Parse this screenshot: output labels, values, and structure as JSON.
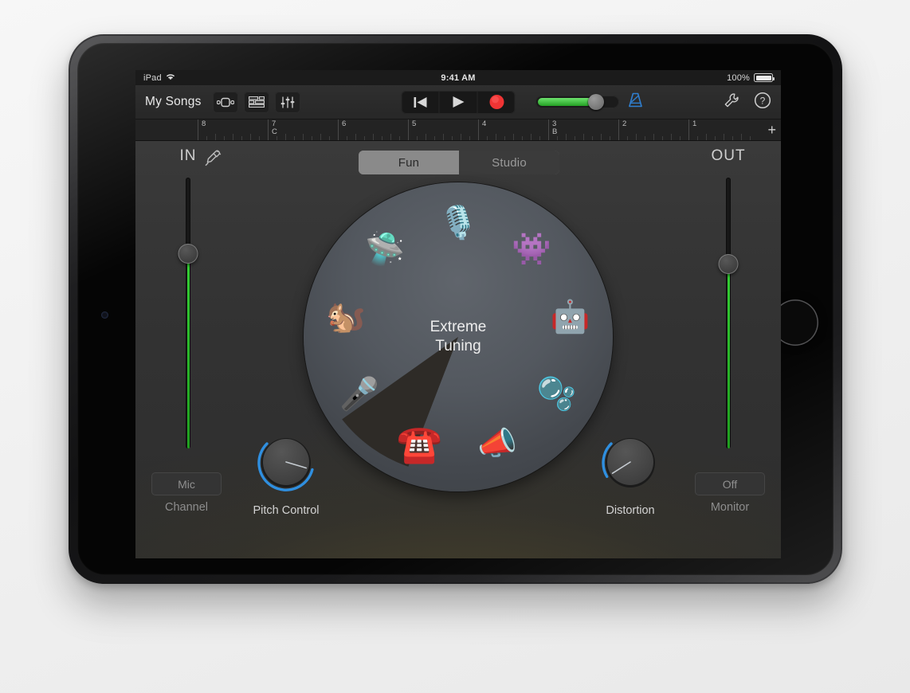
{
  "status_bar": {
    "device": "iPad",
    "wifi_icon": "wifi-icon",
    "time": "9:41 AM",
    "battery_percent": "100%"
  },
  "toolbar": {
    "my_songs_label": "My Songs",
    "icons": [
      {
        "name": "instrument-view-icon",
        "label": "Instrument View"
      },
      {
        "name": "tracks-view-icon",
        "label": "Tracks View"
      },
      {
        "name": "mixer-icon",
        "label": "Mixer"
      }
    ],
    "transport": {
      "rewind_label": "Rewind",
      "play_label": "Play",
      "record_label": "Record",
      "record_color": "#f03030"
    },
    "master_volume": {
      "value": 72,
      "fill_color": "#35c335"
    },
    "metronome_label": "Metronome",
    "metronome_color": "#2f7fd0",
    "settings_label": "Settings",
    "help_label": "Help"
  },
  "ruler": {
    "bars": [
      {
        "num": "1",
        "marker": ""
      },
      {
        "num": "2",
        "marker": ""
      },
      {
        "num": "3",
        "marker": "B"
      },
      {
        "num": "4",
        "marker": ""
      },
      {
        "num": "5",
        "marker": ""
      },
      {
        "num": "6",
        "marker": ""
      },
      {
        "num": "7",
        "marker": "C"
      },
      {
        "num": "8",
        "marker": ""
      }
    ],
    "add_label": "+"
  },
  "main": {
    "segmented": {
      "selected": "Fun",
      "options": [
        {
          "label": "Fun",
          "selected": true
        },
        {
          "label": "Studio",
          "selected": false
        }
      ]
    },
    "input": {
      "label": "IN",
      "plug_icon": "guitar-plug-icon",
      "level_percent": 72,
      "channel_button": "Mic",
      "channel_sublabel": "Channel"
    },
    "output": {
      "label": "OUT",
      "level_percent": 68,
      "monitor_button": "Off",
      "monitor_sublabel": "Monitor"
    },
    "knobs": [
      {
        "name": "Pitch Control",
        "value": 78,
        "arc_color": "#2f8fe0"
      },
      {
        "name": "Distortion",
        "value": 28,
        "arc_color": "#2f8fe0"
      }
    ],
    "wheel": {
      "selected_label_line1": "Extreme",
      "selected_label_line2": "Tuning",
      "selected_index": 5,
      "presets": [
        {
          "name": "vintage-microphone-icon",
          "glyph": "🎙️",
          "label": "Vintage Mic"
        },
        {
          "name": "monster-icon",
          "glyph": "👾",
          "label": "Monster"
        },
        {
          "name": "robot-icon",
          "glyph": "🤖",
          "label": "Robot"
        },
        {
          "name": "bubbles-icon",
          "glyph": "🫧",
          "label": "Bubbles"
        },
        {
          "name": "megaphone-icon",
          "glyph": "📣",
          "label": "Megaphone"
        },
        {
          "name": "telephone-icon",
          "glyph": "☎️",
          "label": "Telephone"
        },
        {
          "name": "gold-microphone-icon",
          "glyph": "🎤",
          "label": "Extreme Tuning"
        },
        {
          "name": "chipmunk-icon",
          "glyph": "🐿️",
          "label": "Chipmunk"
        },
        {
          "name": "ufo-icon",
          "glyph": "🛸",
          "label": "Alien"
        }
      ]
    }
  }
}
